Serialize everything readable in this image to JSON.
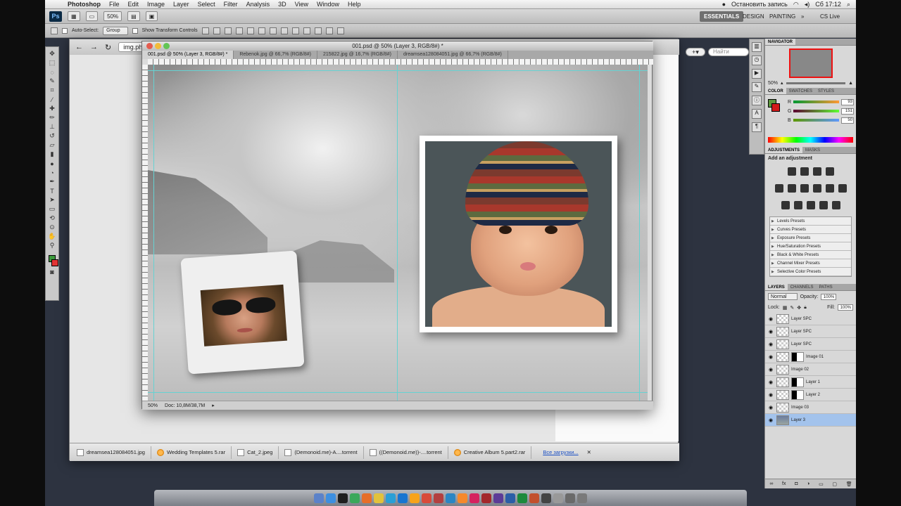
{
  "menubar": {
    "app": "Photoshop",
    "items": [
      "File",
      "Edit",
      "Image",
      "Layer",
      "Select",
      "Filter",
      "Analysis",
      "3D",
      "View",
      "Window",
      "Help"
    ],
    "record": "Остановить запись",
    "clock": "Сб 17:12"
  },
  "appbar": {
    "logo": "Ps",
    "zoom": "50%",
    "workspaces": [
      "ESSENTIALS",
      "DESIGN",
      "PAINTING"
    ],
    "more": "»",
    "cslive": "CS Live"
  },
  "options": {
    "auto_select": "Auto-Select:",
    "group": "Group",
    "show_transform": "Show Transform Controls"
  },
  "browser": {
    "url": "img.ph",
    "search_placeholder": "Найти",
    "downloads": [
      {
        "name": "dreamsea128084051.jpg"
      },
      {
        "name": "Wedding Templates 5.rar"
      },
      {
        "name": "Cat_2.jpeg"
      },
      {
        "name": "(Demonoid.me)-A....torrent"
      },
      {
        "name": "((Demonoid.me))-....torrent"
      },
      {
        "name": "Creative Album 5.part2.rar"
      }
    ],
    "all_downloads": "Все загрузки..."
  },
  "document": {
    "title": "001.psd @ 50% (Layer 3, RGB/8#) *",
    "tabs": [
      "001.psd @ 50% (Layer 3, RGB/8#) *",
      "Rebenok.jpg @ 66,7% (RGB/8#)",
      "215822.jpg @ 16,7% (RGB/8#)",
      "dreamsea128084051.jpg @ 66,7% (RGB/8#)"
    ],
    "status_zoom": "50%",
    "status_doc": "Doc: 10,8M/38,7M"
  },
  "navigator": {
    "title": "NAVIGATOR",
    "zoom": "50%"
  },
  "color": {
    "tabs": [
      "COLOR",
      "SWATCHES",
      "STYLES"
    ],
    "r_label": "R",
    "g_label": "G",
    "b_label": "B",
    "r": "93",
    "g": "151",
    "b": "50",
    "fg": "#5d973f",
    "bg": "#d11a1a"
  },
  "adjustments": {
    "tabs": [
      "ADJUSTMENTS",
      "MASKS"
    ],
    "label": "Add an adjustment",
    "presets": [
      "Levels Presets",
      "Curves Presets",
      "Exposure Presets",
      "Hue/Saturation Presets",
      "Black & White Presets",
      "Channel Mixer Presets",
      "Selective Color Presets"
    ]
  },
  "layers": {
    "tabs": [
      "LAYERS",
      "CHANNELS",
      "PATHS"
    ],
    "blend": "Normal",
    "opacity_label": "Opacity:",
    "opacity": "100%",
    "lock_label": "Lock:",
    "fill_label": "Fill:",
    "fill": "100%",
    "items": [
      {
        "name": "Layer SPC"
      },
      {
        "name": "Layer SPC"
      },
      {
        "name": "Layer SPC"
      },
      {
        "name": "Image 01"
      },
      {
        "name": "Image 02"
      },
      {
        "name": "Layer 1"
      },
      {
        "name": "Layer 2"
      },
      {
        "name": "Image 03"
      },
      {
        "name": "Layer 3"
      }
    ]
  }
}
